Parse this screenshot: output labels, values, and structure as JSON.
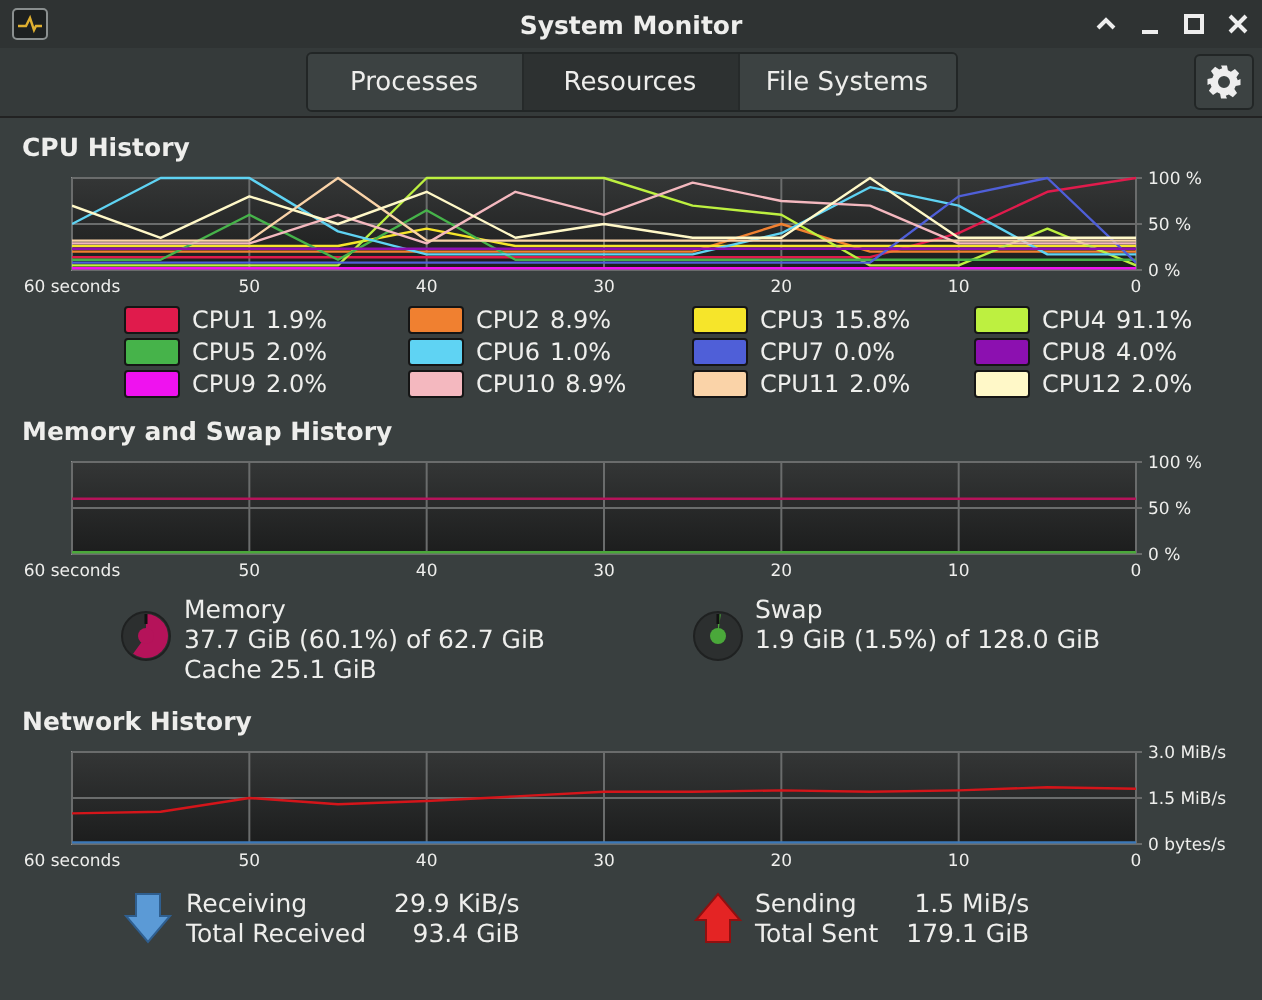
{
  "window": {
    "title": "System Monitor"
  },
  "tabs": [
    {
      "label": "Processes",
      "selected": false
    },
    {
      "label": "Resources",
      "selected": true
    },
    {
      "label": "File Systems",
      "selected": false
    }
  ],
  "cpu": {
    "title": "CPU History",
    "chart_data": {
      "type": "line",
      "grid": true,
      "x": [
        60,
        55,
        50,
        45,
        40,
        35,
        30,
        25,
        20,
        15,
        10,
        5,
        0
      ],
      "xlim": [
        60,
        0
      ],
      "ylim": [
        0,
        100
      ],
      "xticks": [
        {
          "value": 60,
          "label": "60 seconds"
        },
        50,
        40,
        30,
        20,
        10,
        0
      ],
      "yticks": [
        {
          "value": 0,
          "label": "0 %"
        },
        {
          "value": 50,
          "label": "50 %"
        },
        {
          "value": 100,
          "label": "100 %"
        }
      ],
      "series": [
        {
          "name": "CPU1",
          "color": "#e01b4c",
          "values": [
            14,
            14,
            14,
            14,
            14,
            14,
            14,
            14,
            14,
            14,
            40,
            85,
            100
          ]
        },
        {
          "name": "CPU2",
          "color": "#f08030",
          "values": [
            20,
            20,
            20,
            20,
            20,
            20,
            20,
            20,
            50,
            20,
            20,
            20,
            20
          ]
        },
        {
          "name": "CPU3",
          "color": "#f6e52a",
          "values": [
            26,
            26,
            26,
            26,
            45,
            26,
            26,
            26,
            26,
            26,
            26,
            26,
            26
          ]
        },
        {
          "name": "CPU4",
          "color": "#bdf040",
          "values": [
            5,
            5,
            5,
            5,
            100,
            100,
            100,
            70,
            60,
            5,
            5,
            45,
            5
          ]
        },
        {
          "name": "CPU5",
          "color": "#46b34a",
          "values": [
            11,
            11,
            60,
            11,
            65,
            11,
            11,
            11,
            11,
            11,
            11,
            11,
            11
          ]
        },
        {
          "name": "CPU6",
          "color": "#5fd3f3",
          "values": [
            50,
            100,
            100,
            42,
            17,
            17,
            17,
            17,
            40,
            90,
            70,
            17,
            17
          ]
        },
        {
          "name": "CPU7",
          "color": "#4f5fd8",
          "values": [
            8,
            8,
            8,
            8,
            8,
            8,
            8,
            8,
            8,
            8,
            80,
            100,
            8
          ]
        },
        {
          "name": "CPU8",
          "color": "#8c10b0",
          "values": [
            23,
            23,
            23,
            23,
            23,
            23,
            23,
            23,
            23,
            23,
            23,
            23,
            23
          ]
        },
        {
          "name": "CPU9",
          "color": "#ef12ef",
          "values": [
            2,
            2,
            2,
            2,
            2,
            2,
            2,
            2,
            2,
            2,
            2,
            2,
            2
          ]
        },
        {
          "name": "CPU10",
          "color": "#f4b8bf",
          "values": [
            29,
            29,
            29,
            60,
            29,
            85,
            60,
            95,
            75,
            70,
            29,
            29,
            29
          ]
        },
        {
          "name": "CPU11",
          "color": "#fad3a8",
          "values": [
            32,
            32,
            32,
            100,
            32,
            32,
            32,
            32,
            32,
            32,
            32,
            32,
            32
          ]
        },
        {
          "name": "CPU12",
          "color": "#fff8c8",
          "values": [
            70,
            35,
            80,
            50,
            85,
            35,
            50,
            35,
            35,
            100,
            35,
            35,
            35
          ]
        }
      ]
    },
    "readings": [
      "1.9%",
      "8.9%",
      "15.8%",
      "91.1%",
      "2.0%",
      "1.0%",
      "0.0%",
      "4.0%",
      "2.0%",
      "8.9%",
      "2.0%",
      "2.0%"
    ]
  },
  "memory": {
    "title": "Memory and Swap History",
    "chart_data": {
      "type": "line",
      "grid": true,
      "x": [
        60,
        0
      ],
      "xlim": [
        60,
        0
      ],
      "ylim": [
        0,
        100
      ],
      "xticks": [
        {
          "value": 60,
          "label": "60 seconds"
        },
        50,
        40,
        30,
        20,
        10,
        0
      ],
      "yticks": [
        {
          "value": 0,
          "label": "0 %"
        },
        {
          "value": 50,
          "label": "50 %"
        },
        {
          "value": 100,
          "label": "100 %"
        }
      ],
      "series": [
        {
          "name": "Memory",
          "color": "#b5135a",
          "values": [
            60,
            60
          ]
        },
        {
          "name": "Swap",
          "color": "#4aa83a",
          "values": [
            2,
            2
          ]
        }
      ]
    },
    "items": [
      {
        "detail": "37.7 GiB (60.1%) of 62.7 GiB",
        "cache": "Cache 25.1 GiB"
      },
      {
        "detail": "1.9 GiB (1.5%) of 128.0 GiB"
      }
    ]
  },
  "network": {
    "title": "Network History",
    "chart_data": {
      "type": "line",
      "grid": true,
      "x": [
        60,
        55,
        50,
        45,
        40,
        35,
        30,
        25,
        20,
        15,
        10,
        5,
        0
      ],
      "xlim": [
        60,
        0
      ],
      "ylim": [
        0,
        3
      ],
      "xticks": [
        {
          "value": 60,
          "label": "60 seconds"
        },
        50,
        40,
        30,
        20,
        10,
        0
      ],
      "yticks": [
        {
          "value": 0,
          "label": "0 bytes/s"
        },
        {
          "value": 1.5,
          "label": "1.5 MiB/s"
        },
        {
          "value": 3,
          "label": "3.0 MiB/s"
        }
      ],
      "series": [
        {
          "name": "Receiving",
          "color": "#3b78b8",
          "values": [
            0.05,
            0.05,
            0.05,
            0.05,
            0.05,
            0.05,
            0.05,
            0.05,
            0.05,
            0.05,
            0.05,
            0.05,
            0.05
          ]
        },
        {
          "name": "Sending",
          "color": "#d4151a",
          "values": [
            1.0,
            1.05,
            1.5,
            1.3,
            1.4,
            1.55,
            1.7,
            1.7,
            1.75,
            1.7,
            1.75,
            1.85,
            1.8
          ]
        }
      ]
    },
    "items": [
      {
        "kind": "receiving",
        "rate": "29.9 KiB/s",
        "total_label": "Total Received",
        "total": "93.4 GiB"
      },
      {
        "kind": "sending",
        "rate": "1.5 MiB/s",
        "total_label": "Total Sent",
        "total": "179.1 GiB"
      }
    ]
  }
}
